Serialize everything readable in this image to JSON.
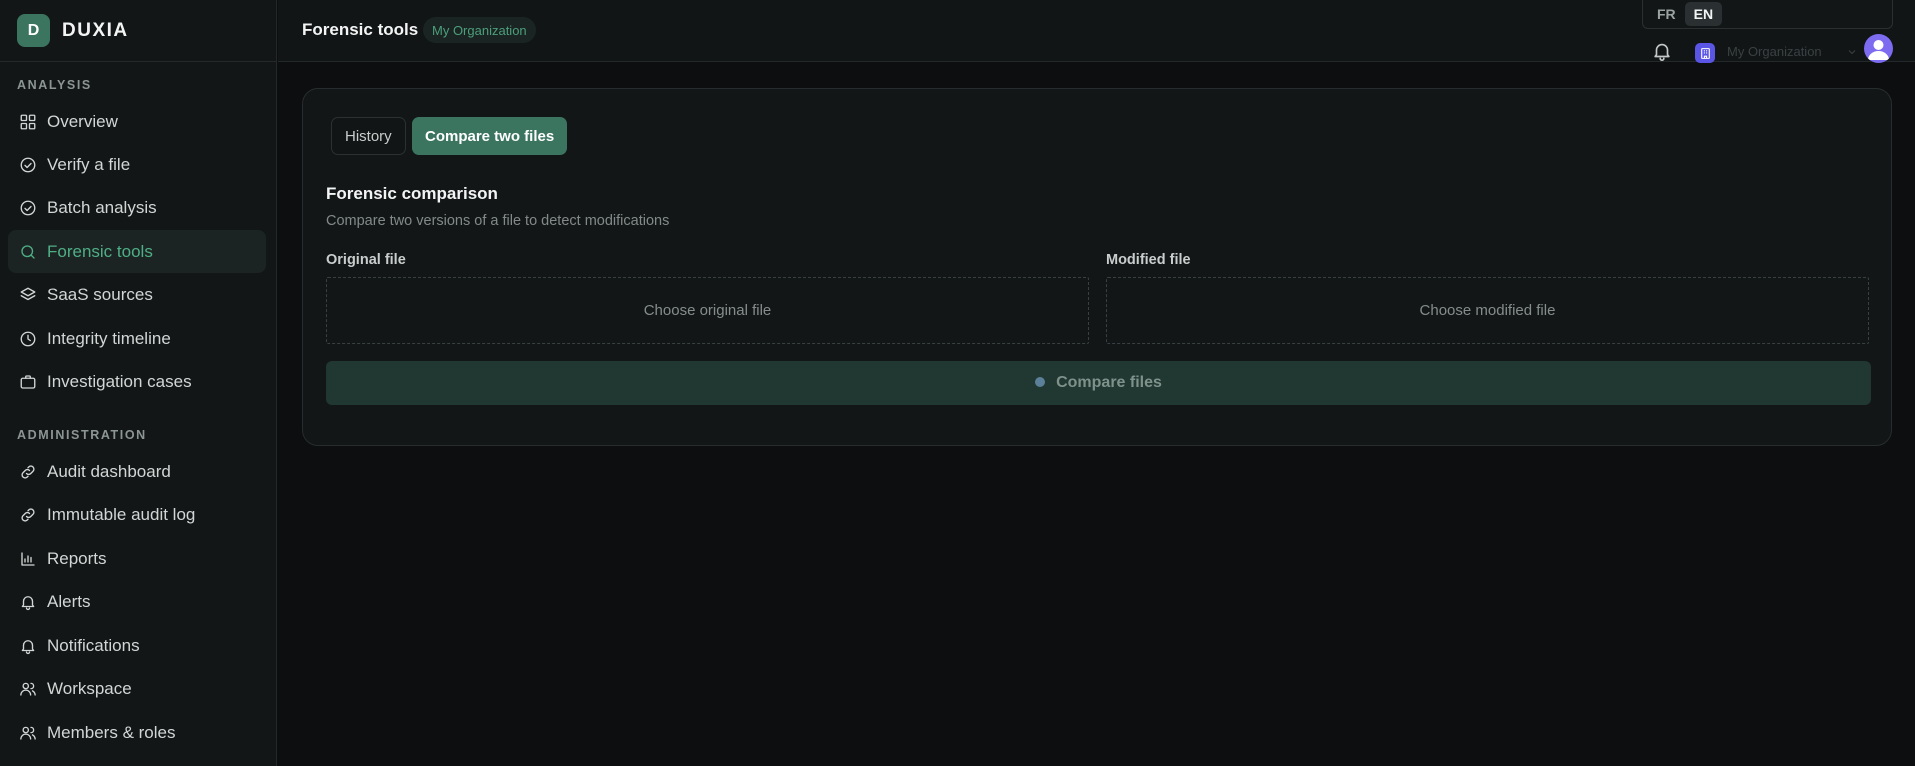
{
  "brand": {
    "initial": "D",
    "name": "DUXIA"
  },
  "sidebar": {
    "sections": [
      {
        "title": "ANALYSIS"
      },
      {
        "title": "ADMINISTRATION"
      }
    ],
    "items": [
      {
        "label": "Overview",
        "icon": "grid-icon"
      },
      {
        "label": "Verify a file",
        "icon": "check-circle-icon"
      },
      {
        "label": "Batch analysis",
        "icon": "check-circle-icon"
      },
      {
        "label": "Forensic tools",
        "icon": "search-icon",
        "active": true
      },
      {
        "label": "SaaS sources",
        "icon": "layers-icon"
      },
      {
        "label": "Integrity timeline",
        "icon": "clock-icon"
      },
      {
        "label": "Investigation cases",
        "icon": "briefcase-icon"
      },
      {
        "label": "Audit dashboard",
        "icon": "link-icon"
      },
      {
        "label": "Immutable audit log",
        "icon": "link-icon"
      },
      {
        "label": "Reports",
        "icon": "bar-chart-icon"
      },
      {
        "label": "Alerts",
        "icon": "bell-icon"
      },
      {
        "label": "Notifications",
        "icon": "bell-icon"
      },
      {
        "label": "Workspace",
        "icon": "users-icon"
      },
      {
        "label": "Members & roles",
        "icon": "users-icon"
      }
    ]
  },
  "header": {
    "title": "Forensic tools",
    "org_badge": "My Organization",
    "languages": [
      "FR",
      "EN"
    ],
    "active_language": "EN",
    "org_switcher_label": "My Organization"
  },
  "main": {
    "tabs": [
      {
        "label": "History"
      },
      {
        "label": "Compare two files",
        "active": true
      }
    ],
    "heading": "Forensic comparison",
    "description": "Compare two versions of a file to detect modifications",
    "original_label": "Original file",
    "original_placeholder": "Choose original file",
    "modified_label": "Modified file",
    "modified_placeholder": "Choose modified file",
    "compare_button": "Compare files"
  },
  "colors": {
    "accent": "#3b7560",
    "active_text": "#4fae86",
    "background": "#0c0e0f",
    "panel": "#121617",
    "org_icon": "#5b55e6",
    "avatar": "#7d6bf0"
  }
}
